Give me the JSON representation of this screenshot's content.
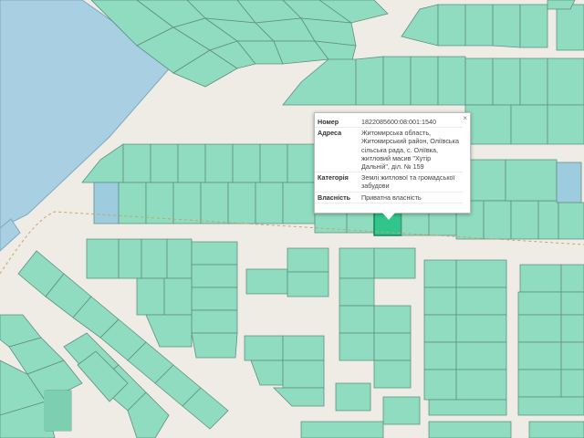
{
  "map": {
    "colors": {
      "background": "#efece6",
      "parcel": "#8fdcc0",
      "parcel_blue": "#9dccdf",
      "water": "#a8cfe2",
      "selected_parcel": "#2fc58b"
    }
  },
  "popup": {
    "close_label": "×",
    "rows": [
      {
        "key": "Номер",
        "value": "1822085600:08:001:1540"
      },
      {
        "key": "Адреса",
        "value": "Житомирська область, Житомирський район, Оліївська сільська рада, с. Оліївка, житловий масив \"Хутір Дальній\", діл. № 159"
      },
      {
        "key": "Категорія",
        "value": "Землі житлової та громадської забудови"
      },
      {
        "key": "Власність",
        "value": "Приватна власність"
      }
    ]
  }
}
